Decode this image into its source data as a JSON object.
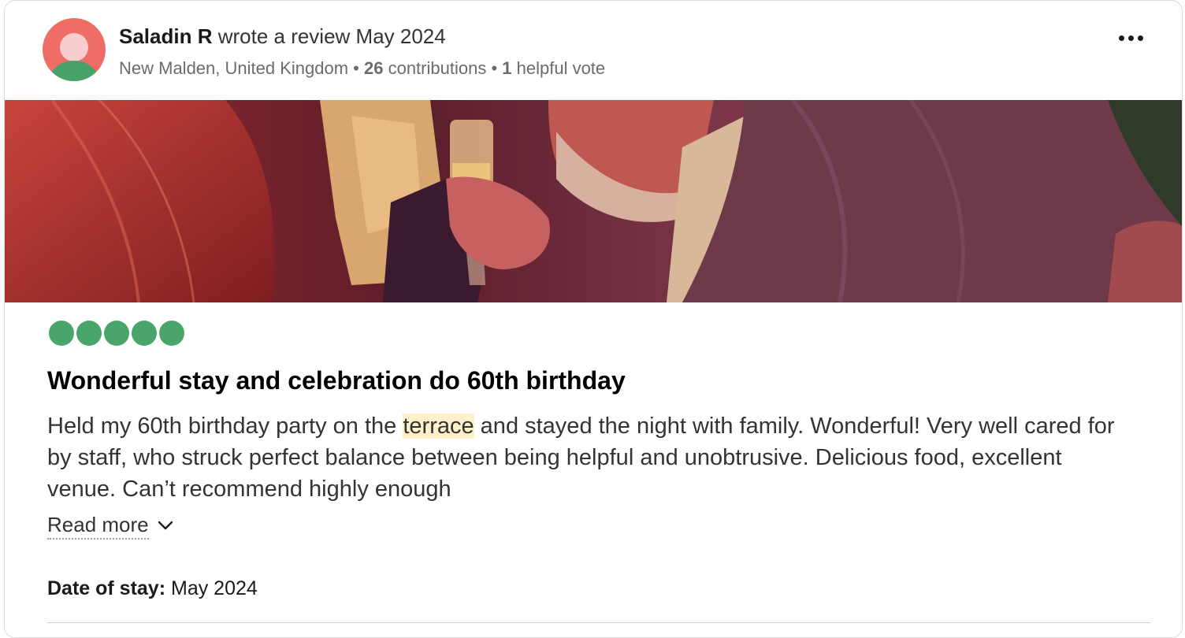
{
  "review": {
    "user": {
      "name": "Saladin R",
      "action": " wrote a review May 2024",
      "location": "New Malden, United Kingdom",
      "sep1": " • ",
      "contributions_count": "26",
      "contributions_label": " contributions",
      "sep2": " • ",
      "helpful_count": "1",
      "helpful_label": " helpful vote"
    },
    "rating": 5,
    "title": "Wonderful stay and celebration do 60th birthday",
    "body_before": "Held my 60th birthday party on the ",
    "body_highlight": "terrace",
    "body_after": " and stayed the night with family. Wonderful! Very well cared for by staff, who struck perfect balance between being helpful and unobtrusive. Delicious food, excellent venue. Can’t recommend highly enough",
    "read_more": "Read more",
    "date_of_stay_label": "Date of stay:",
    "date_of_stay_value": " May 2024"
  },
  "icons": {
    "more": "more-horizontal-icon",
    "chevron": "chevron-down-icon"
  },
  "colors": {
    "rating_bubble": "#4aa56a",
    "avatar_bg": "#ee6d66",
    "highlight": "#fdf1c9"
  }
}
